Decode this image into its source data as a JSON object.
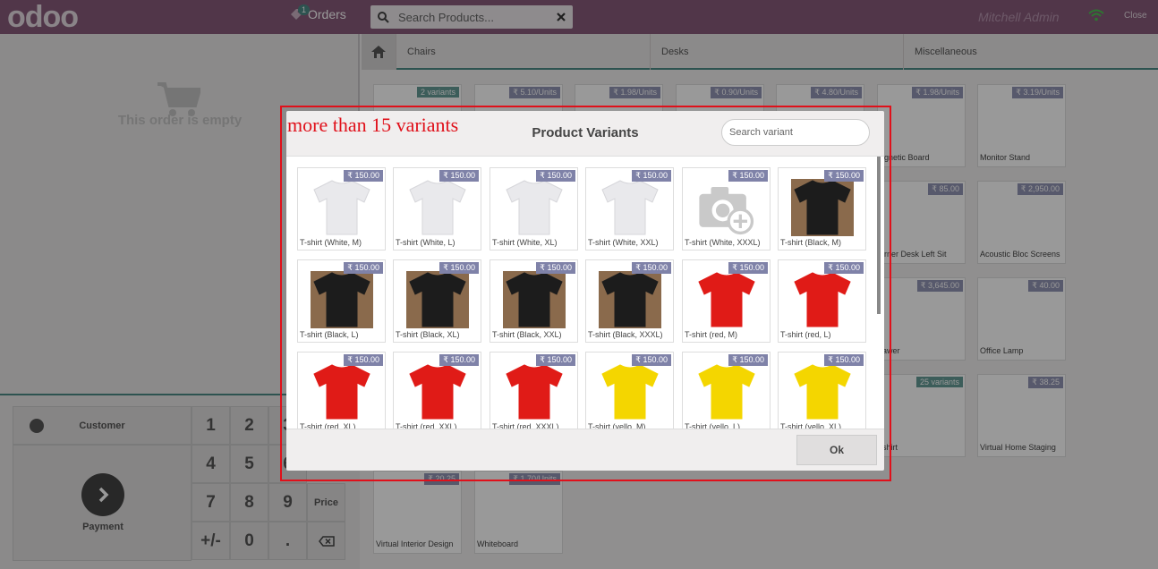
{
  "topbar": {
    "logo": "odoo",
    "orders_label": "Orders",
    "orders_count": "1",
    "search_placeholder": "Search Products...",
    "user": "Mitchell Admin",
    "close_label": "Close"
  },
  "order": {
    "empty_text": "This order is empty"
  },
  "pad": {
    "customer_label": "Customer",
    "payment_label": "Payment",
    "keys": [
      "1",
      "2",
      "3",
      "4",
      "5",
      "6",
      "7",
      "8",
      "9",
      "Price",
      "+/-",
      "0",
      "."
    ]
  },
  "categories": [
    "Chairs",
    "Desks",
    "Miscellaneous"
  ],
  "background_products": [
    {
      "name": "",
      "price": "",
      "badge": "2 variants"
    },
    {
      "name": "",
      "price": "₹ 5.10/Units",
      "badge": ""
    },
    {
      "name": "",
      "price": "₹ 1.98/Units",
      "badge": ""
    },
    {
      "name": "",
      "price": "₹ 0.90/Units",
      "badge": ""
    },
    {
      "name": "",
      "price": "₹ 4.80/Units",
      "badge": ""
    },
    {
      "name": "agnetic Board",
      "price": "₹ 1.98/Units",
      "badge": ""
    },
    {
      "name": "Monitor Stand",
      "price": "₹ 3.19/Units",
      "badge": ""
    },
    {
      "name": "orner Desk Left Sit",
      "price": "₹ 85.00",
      "badge": ""
    },
    {
      "name": "Acoustic Bloc Screens",
      "price": "₹ 2,950.00",
      "badge": ""
    },
    {
      "name": "rawer",
      "price": "₹ 3,645.00",
      "badge": ""
    },
    {
      "name": "Office Lamp",
      "price": "₹ 40.00",
      "badge": ""
    },
    {
      "name": "-shirt",
      "price": "",
      "badge": "25 variants"
    },
    {
      "name": "Virtual Home Staging",
      "price": "₹ 38.25",
      "badge": ""
    },
    {
      "name": "Virtual Interior Design",
      "price": "₹ 20.25",
      "badge": ""
    },
    {
      "name": "Whiteboard",
      "price": "₹ 1.70/Units",
      "badge": ""
    }
  ],
  "modal": {
    "title": "Product Variants",
    "search_placeholder": "Search variant",
    "ok_label": "Ok",
    "variants": [
      {
        "name": "T-shirt (White, M)",
        "price": "₹ 150.00",
        "color": "white"
      },
      {
        "name": "T-shirt (White, L)",
        "price": "₹ 150.00",
        "color": "white"
      },
      {
        "name": "T-shirt (White, XL)",
        "price": "₹ 150.00",
        "color": "white"
      },
      {
        "name": "T-shirt (White, XXL)",
        "price": "₹ 150.00",
        "color": "white"
      },
      {
        "name": "T-shirt (White, XXXL)",
        "price": "₹ 150.00",
        "color": "placeholder"
      },
      {
        "name": "T-shirt (Black, M)",
        "price": "₹ 150.00",
        "color": "black"
      },
      {
        "name": "T-shirt (Black, L)",
        "price": "₹ 150.00",
        "color": "black"
      },
      {
        "name": "T-shirt (Black, XL)",
        "price": "₹ 150.00",
        "color": "black"
      },
      {
        "name": "T-shirt (Black, XXL)",
        "price": "₹ 150.00",
        "color": "black"
      },
      {
        "name": "T-shirt (Black, XXXL)",
        "price": "₹ 150.00",
        "color": "black"
      },
      {
        "name": "T-shirt (red, M)",
        "price": "₹ 150.00",
        "color": "red"
      },
      {
        "name": "T-shirt (red, L)",
        "price": "₹ 150.00",
        "color": "red"
      },
      {
        "name": "T-shirt (red, XL)",
        "price": "₹ 150.00",
        "color": "red"
      },
      {
        "name": "T-shirt (red, XXL)",
        "price": "₹ 150.00",
        "color": "red"
      },
      {
        "name": "T-shirt (red, XXXL)",
        "price": "₹ 150.00",
        "color": "red"
      },
      {
        "name": "T-shirt (yello, M)",
        "price": "₹ 150.00",
        "color": "yellow"
      },
      {
        "name": "T-shirt (yello, L)",
        "price": "₹ 150.00",
        "color": "yellow"
      },
      {
        "name": "T-shirt (yello, XL)",
        "price": "₹ 150.00",
        "color": "yellow"
      }
    ]
  },
  "annotation": {
    "text": "more than 15 variants",
    "color": "#e0101a"
  },
  "colors": {
    "brand": "#875a7b",
    "accent": "#4b8b85",
    "price_tag": "#7f82a8"
  }
}
